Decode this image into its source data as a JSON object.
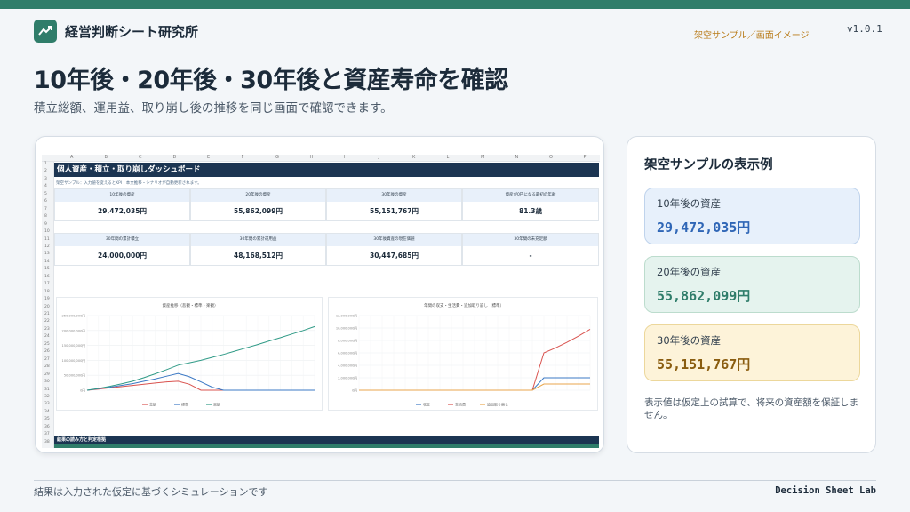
{
  "brand": {
    "name": "経営判断シート研究所"
  },
  "header": {
    "sample_tag": "架空サンプル／画面イメージ",
    "version": "v1.0.1"
  },
  "hero": {
    "title": "10年後・20年後・30年後と資産寿命を確認",
    "subtitle": "積立総額、運用益、取り崩し後の推移を同じ画面で確認できます。"
  },
  "spreadsheet": {
    "columns": [
      "A",
      "B",
      "C",
      "D",
      "E",
      "F",
      "G",
      "H",
      "I",
      "J",
      "K",
      "L",
      "M",
      "N",
      "O",
      "P"
    ],
    "dashboard_title": "個人資産・積立・取り崩しダッシュボード",
    "note": "架空サンプル：入力値を変えるとKPI・本文推移・シナリオが自動更新されます。",
    "metrics_row1": [
      {
        "label": "10年後の資産",
        "value": "29,472,035円"
      },
      {
        "label": "20年後の資産",
        "value": "55,862,099円"
      },
      {
        "label": "30年後の資産",
        "value": "55,151,767円"
      },
      {
        "label": "資産が0円になる最初の年齢",
        "value": "81.3歳"
      }
    ],
    "metrics_row2": [
      {
        "label": "30年間の累計積立",
        "value": "24,000,000円"
      },
      {
        "label": "30年間の累計運用益",
        "value": "48,168,512円"
      },
      {
        "label": "30年後資産の現在価値",
        "value": "30,447,685円"
      },
      {
        "label": "30年間の未充足額",
        "value": "-"
      }
    ],
    "bottom_band": "結果の読み方と判定根拠"
  },
  "chart_data": [
    {
      "type": "line",
      "title": "資産推移（悲観・標準・楽観）",
      "y_ticks": [
        "250,000,000円",
        "200,000,000円",
        "150,000,000円",
        "100,000,000円",
        "50,000,000円",
        "0円"
      ],
      "ylim": [
        0,
        250000000
      ],
      "x": [
        0,
        2,
        4,
        6,
        8,
        10,
        12,
        14,
        16,
        18,
        20,
        22,
        24,
        26,
        28,
        30,
        32,
        34,
        36,
        38,
        40
      ],
      "series": [
        {
          "name": "悲観",
          "color": "#d9534f",
          "values": [
            0,
            4000000.0,
            8000000.0,
            12000000.0,
            16000000.0,
            20000000.0,
            24000000.0,
            28000000.0,
            30000000.0,
            20000000.0,
            0,
            0,
            0,
            0,
            0,
            0,
            0,
            0,
            0,
            0,
            0
          ]
        },
        {
          "name": "標準",
          "color": "#3b78c4",
          "values": [
            0,
            5000000.0,
            10000000.0,
            16000000.0,
            22000000.0,
            30000000.0,
            38000000.0,
            47000000.0,
            56000000.0,
            45000000.0,
            28000000.0,
            10000000.0,
            0,
            0,
            0,
            0,
            0,
            0,
            0,
            0,
            0
          ]
        },
        {
          "name": "楽観",
          "color": "#2f9a86",
          "values": [
            0,
            6000000.0,
            13000000.0,
            21000000.0,
            30000000.0,
            42000000.0,
            55000000.0,
            69000000.0,
            84000000.0,
            92000000.0,
            100000000.0,
            110000000.0,
            120000000.0,
            131000000.0,
            142000000.0,
            153000000.0,
            165000000.0,
            176000000.0,
            188000000.0,
            200000000.0,
            213000000.0
          ]
        }
      ]
    },
    {
      "type": "line",
      "title": "年間の収支・生活費・追加取り崩し（標準）",
      "y_ticks": [
        "12,000,000円",
        "10,000,000円",
        "8,000,000円",
        "6,000,000円",
        "4,000,000円",
        "2,000,000円",
        "0円"
      ],
      "ylim": [
        0,
        12000000
      ],
      "x": [
        0,
        2,
        4,
        6,
        8,
        10,
        12,
        14,
        16,
        18,
        20,
        22,
        24,
        26,
        28,
        30,
        32,
        34,
        36,
        38,
        40
      ],
      "series": [
        {
          "name": "収支",
          "color": "#3b78c4",
          "values": [
            0,
            0,
            0,
            0,
            0,
            0,
            0,
            0,
            0,
            0,
            0,
            0,
            0,
            0,
            0,
            0,
            2000000,
            2000000,
            2000000,
            2000000,
            2000000
          ]
        },
        {
          "name": "生活費",
          "color": "#d9534f",
          "values": [
            0,
            0,
            0,
            0,
            0,
            0,
            0,
            0,
            0,
            0,
            0,
            0,
            0,
            0,
            0,
            0,
            6000000,
            6800000,
            7700000,
            8700000,
            9800000
          ]
        },
        {
          "name": "追加取り崩し",
          "color": "#e8a64c",
          "values": [
            0,
            0,
            0,
            0,
            0,
            0,
            0,
            0,
            0,
            0,
            0,
            0,
            0,
            0,
            0,
            0,
            1000000,
            1000000,
            1000000,
            1000000,
            1000000
          ]
        }
      ]
    }
  ],
  "side": {
    "title": "架空サンプルの表示例",
    "stats": [
      {
        "label": "10年後の資産",
        "value": "29,472,035円"
      },
      {
        "label": "20年後の資産",
        "value": "55,862,099円"
      },
      {
        "label": "30年後の資産",
        "value": "55,151,767円"
      }
    ],
    "disclaimer": "表示値は仮定上の試算で、将来の資産額を保証しません。"
  },
  "footer": {
    "left": "結果は入力された仮定に基づくシミュレーションです",
    "right": "Decision Sheet Lab"
  }
}
